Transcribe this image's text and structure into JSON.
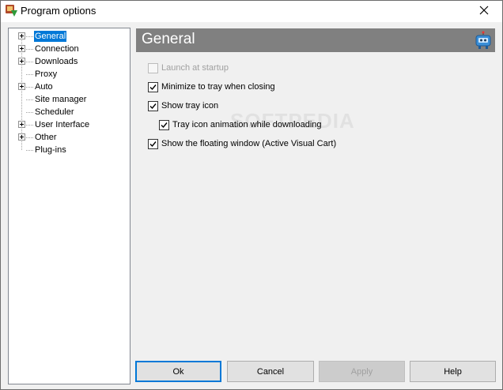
{
  "window": {
    "title": "Program options",
    "app_icon": "program-options-icon",
    "close_icon": "close-icon"
  },
  "tree": {
    "items": [
      {
        "label": "General",
        "expandable": true,
        "selected": true
      },
      {
        "label": "Connection",
        "expandable": true,
        "selected": false
      },
      {
        "label": "Downloads",
        "expandable": true,
        "selected": false
      },
      {
        "label": "Proxy",
        "expandable": false,
        "selected": false
      },
      {
        "label": "Auto",
        "expandable": true,
        "selected": false
      },
      {
        "label": "Site manager",
        "expandable": false,
        "selected": false
      },
      {
        "label": "Scheduler",
        "expandable": false,
        "selected": false
      },
      {
        "label": "User Interface",
        "expandable": true,
        "selected": false
      },
      {
        "label": "Other",
        "expandable": true,
        "selected": false
      },
      {
        "label": "Plug-ins",
        "expandable": false,
        "selected": false
      }
    ]
  },
  "panel": {
    "title": "General",
    "icon": "robot-icon",
    "options": [
      {
        "label": "Launch at startup",
        "checked": false,
        "disabled": true
      },
      {
        "label": "Minimize to tray when closing",
        "checked": true,
        "disabled": false
      },
      {
        "label": "Show tray icon",
        "checked": true,
        "disabled": false
      },
      {
        "label": "Tray icon animation while downloading",
        "checked": true,
        "disabled": false
      },
      {
        "label": "Show the floating window (Active Visual Cart)",
        "checked": true,
        "disabled": false
      }
    ],
    "watermark": "SOFTPEDIA"
  },
  "buttons": {
    "ok": "Ok",
    "cancel": "Cancel",
    "apply": "Apply",
    "help": "Help"
  },
  "colors": {
    "selection": "#0078d7",
    "header_bg": "#808080",
    "window_bg": "#f0f0f0"
  }
}
